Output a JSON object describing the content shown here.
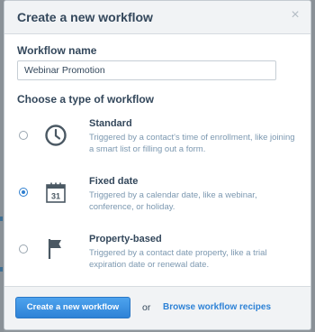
{
  "dialog": {
    "title": "Create a new workflow",
    "close_symbol": "×"
  },
  "name_field": {
    "label": "Workflow name",
    "value": "Webinar Promotion"
  },
  "type_section": {
    "title": "Choose a type of workflow",
    "options": [
      {
        "title": "Standard",
        "description": "Triggered by a contact's time of enrollment, like joining a smart list or filling out a form.",
        "icon": "clock-icon",
        "selected": false
      },
      {
        "title": "Fixed date",
        "description": "Triggered by a calendar date, like a webinar, conference, or holiday.",
        "icon": "calendar-icon",
        "calendar_day": "31",
        "selected": true
      },
      {
        "title": "Property-based",
        "description": "Triggered by a contact date property, like a trial expiration date or renewal date.",
        "icon": "flag-icon",
        "selected": false
      }
    ]
  },
  "footer": {
    "primary_label": "Create a new workflow",
    "or_text": "or",
    "recipes_label": "Browse workflow recipes"
  },
  "colors": {
    "accent": "#2e82d6",
    "header_bg": "#f1f3f5",
    "text": "#33475b",
    "muted_text": "#7c98b0"
  }
}
